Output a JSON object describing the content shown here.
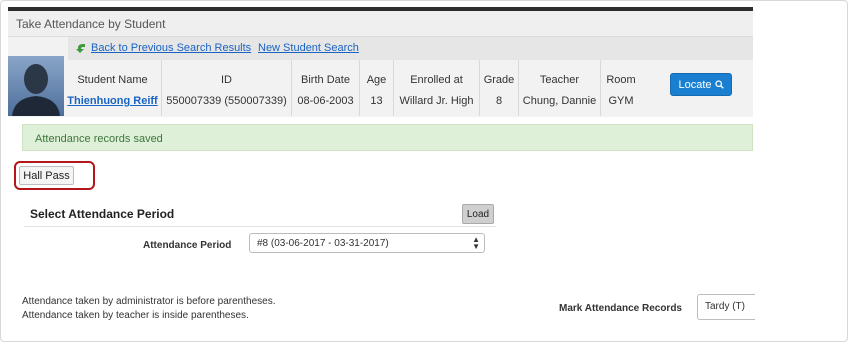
{
  "header": {
    "title": "Take Attendance by Student"
  },
  "links": {
    "back": "Back to Previous Search Results",
    "new_search": "New Student Search"
  },
  "student": {
    "columns": [
      {
        "header": "Student Name",
        "value": "Thienhuong Reiff"
      },
      {
        "header": "ID",
        "value": "550007339 (550007339)"
      },
      {
        "header": "Birth Date",
        "value": "08-06-2003"
      },
      {
        "header": "Age",
        "value": "13"
      },
      {
        "header": "Enrolled at",
        "value": "Willard Jr. High"
      },
      {
        "header": "Grade",
        "value": "8"
      },
      {
        "header": "Teacher",
        "value": "Chung, Dannie"
      },
      {
        "header": "Room",
        "value": "GYM"
      }
    ],
    "locate_label": "Locate",
    "locate_icon": "search-icon"
  },
  "alert": {
    "message": "Attendance records saved",
    "color": "#dff0d8"
  },
  "hall_pass": {
    "label": "Hall Pass",
    "highlight_color": "#b3151b"
  },
  "period_section": {
    "title": "Select Attendance Period",
    "load_label": "Load",
    "field_label": "Attendance Period",
    "selected": "#8 (03-06-2017 - 03-31-2017)"
  },
  "notes": {
    "line1": "Attendance taken by administrator is before parentheses.",
    "line2": "Attendance taken by teacher is inside parentheses."
  },
  "mark_records": {
    "label": "Mark Attendance Records",
    "selected": "Tardy (T)"
  },
  "colors": {
    "accent": "#1b7fd1",
    "link": "#1a63c2"
  }
}
